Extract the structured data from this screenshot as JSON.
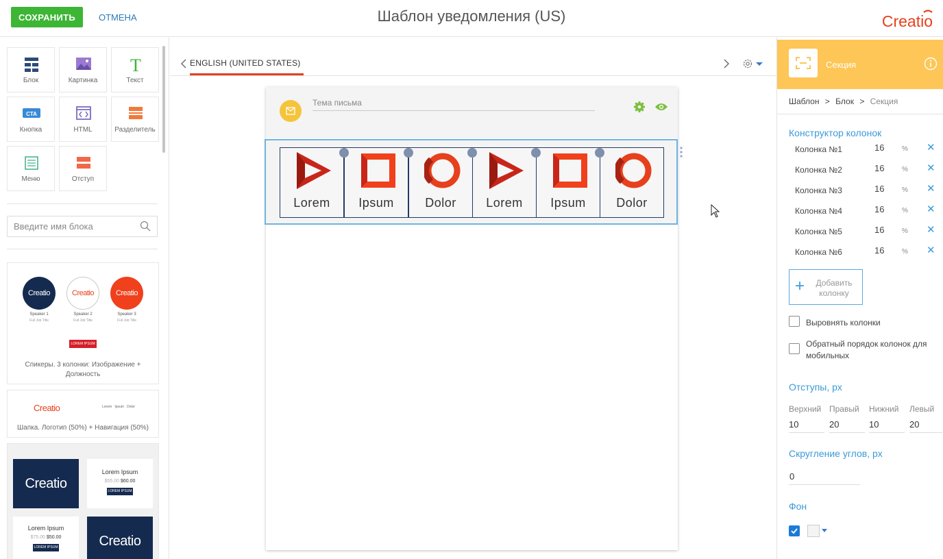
{
  "header": {
    "save_label": "СОХРАНИТЬ",
    "cancel_label": "ОТМЕНА",
    "title": "Шаблон уведомления (US)",
    "logo_text": "Creatio",
    "logo_color": "#e6401c"
  },
  "left_panel": {
    "tools": [
      {
        "label": "Блок",
        "icon": "block-grid-icon"
      },
      {
        "label": "Картинка",
        "icon": "image-icon"
      },
      {
        "label": "Текст",
        "icon": "text-icon"
      },
      {
        "label": "Кнопка",
        "icon": "cta-button-icon"
      },
      {
        "label": "HTML",
        "icon": "html-icon"
      },
      {
        "label": "Разделитель",
        "icon": "divider-icon"
      },
      {
        "label": "Меню",
        "icon": "menu-icon"
      },
      {
        "label": "Отступ",
        "icon": "spacer-icon"
      }
    ],
    "search_placeholder": "Введите имя блока",
    "templates": [
      {
        "caption": "Спикеры. 3 колонки: Изображение + Должность",
        "speakers": [
          {
            "avatar_text": "Creatio",
            "name": "Speaker 1",
            "job": "Full Job Title"
          },
          {
            "avatar_text": "Creatio",
            "name": "Speaker 2",
            "job": "Full Job Title"
          },
          {
            "avatar_text": "Creatio",
            "name": "Speaker 3",
            "job": "Full Job Title"
          }
        ],
        "button_text": "LOREM IPSUM"
      },
      {
        "caption": "Шапка. Логотип (50%) + Навигация (50%)",
        "logo_text": "Creatio",
        "nav_text": "Lorem   Ipsum   Dolor"
      },
      {
        "tiles": [
          {
            "logo_text": "Creatio"
          },
          {
            "title": "Lorem Ipsum",
            "old_price": "$55.00",
            "price": "$60.00",
            "button": "LOREM IPSUM"
          },
          {
            "title": "Lorem Ipsum",
            "old_price": "$75.00",
            "price": "$50.00",
            "button": "LOREM IPSUM"
          },
          {
            "logo_text": "Creatio"
          }
        ]
      }
    ]
  },
  "editor": {
    "language_tab": "ENGLISH (UNITED STATES)",
    "subject_placeholder": "Тема письма",
    "columns": [
      {
        "shape": "triangle",
        "word": "Lorem"
      },
      {
        "shape": "square",
        "word": "Ipsum"
      },
      {
        "shape": "circle",
        "word": "Dolor"
      },
      {
        "shape": "triangle",
        "word": "Lorem"
      },
      {
        "shape": "square",
        "word": "Ipsum"
      },
      {
        "shape": "circle",
        "word": "Dolor"
      }
    ]
  },
  "right_panel": {
    "title": "Секция",
    "breadcrumb": {
      "part1": "Шаблон",
      "sep": ">",
      "part2": "Блок",
      "part3": "Секция"
    },
    "column_builder": {
      "title": "Конструктор колонок",
      "columns": [
        {
          "name": "Колонка №1",
          "value": "16",
          "unit": "%"
        },
        {
          "name": "Колонка №2",
          "value": "16",
          "unit": "%"
        },
        {
          "name": "Колонка №3",
          "value": "16",
          "unit": "%"
        },
        {
          "name": "Колонка №4",
          "value": "16",
          "unit": "%"
        },
        {
          "name": "Колонка №5",
          "value": "16",
          "unit": "%"
        },
        {
          "name": "Колонка №6",
          "value": "16",
          "unit": "%"
        }
      ],
      "add_label": "Добавить колонку"
    },
    "align_columns": {
      "label": "Выровнять колонки",
      "checked": false
    },
    "reverse_mobile": {
      "label": "Обратный порядок колонок для мобильных",
      "checked": false
    },
    "padding": {
      "title": "Отступы, px",
      "top": {
        "label": "Верхний",
        "value": "10"
      },
      "right": {
        "label": "Правый",
        "value": "20"
      },
      "bottom": {
        "label": "Нижний",
        "value": "10"
      },
      "left": {
        "label": "Левый",
        "value": "20"
      }
    },
    "radius": {
      "title": "Скругление углов, px",
      "value": "0"
    },
    "background": {
      "title": "Фон",
      "enabled": true,
      "color": "#f4f4f4"
    }
  }
}
